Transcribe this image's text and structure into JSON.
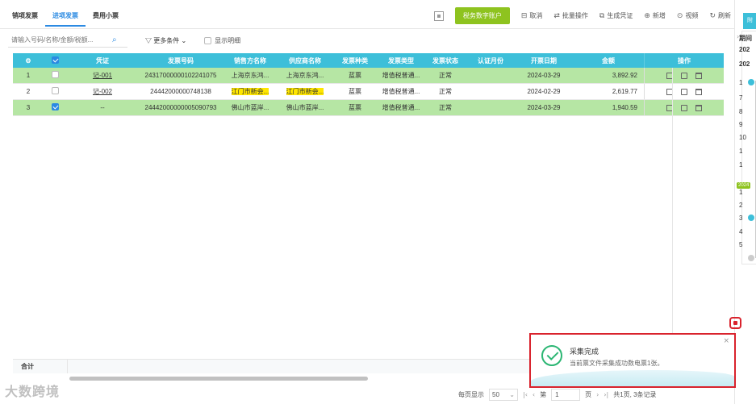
{
  "tabs": [
    {
      "label": "销项发票"
    },
    {
      "label": "进项发票"
    },
    {
      "label": "费用小票"
    }
  ],
  "toolbar": {
    "tax_account_button": "税务数字账户",
    "cancel": "取消",
    "batch": "批量操作",
    "gen_voucher": "生成凭证",
    "add": "新增",
    "video": "视频",
    "refresh": "刷新"
  },
  "filter": {
    "search_placeholder": "请输入号码/名称/金额/税额...",
    "more_conditions": "更多条件",
    "show_detail": "显示明细"
  },
  "table": {
    "headers": [
      "凭证",
      "发票号码",
      "销售方名称",
      "供应商名称",
      "发票种类",
      "发票类型",
      "发票状态",
      "认证月份",
      "开票日期",
      "金额",
      "操作"
    ],
    "rows": [
      {
        "idx": "1",
        "voucher": "记-001",
        "number": "24317000000102241075",
        "seller": "上海京东鸿...",
        "supplier": "上海京东鸿...",
        "kind": "蓝票",
        "type": "增值税普通...",
        "status": "正常",
        "month": "",
        "date": "2024-03-29",
        "amount": "3,892.92",
        "checked": false,
        "highlight": true
      },
      {
        "idx": "2",
        "voucher": "记-002",
        "number": "24442000000748138",
        "seller": "江门市新会...",
        "supplier": "江门市新会...",
        "kind": "蓝票",
        "type": "增值税普通...",
        "status": "正常",
        "month": "",
        "date": "2024-02-29",
        "amount": "2,619.77",
        "checked": false,
        "highlight": false
      },
      {
        "idx": "3",
        "voucher": "--",
        "number": "24442000000005090793",
        "seller": "佛山市蓝岸...",
        "supplier": "佛山市蓝岸...",
        "kind": "蓝票",
        "type": "增值税普通...",
        "status": "正常",
        "month": "",
        "date": "2024-03-29",
        "amount": "1,940.59",
        "checked": true,
        "highlight": true
      }
    ],
    "total_label": "合计"
  },
  "pager": {
    "per_page_label": "每页显示",
    "per_page": "50",
    "page_label_pre": "第",
    "page": "1",
    "page_label_post": "页",
    "summary": "共1页, 3条记录"
  },
  "right_panel": {
    "tab": "附",
    "items": [
      "期间",
      "202",
      "202",
      "1",
      "7",
      "8",
      "9",
      "10",
      "1",
      "1",
      "1",
      "2",
      "3",
      "4",
      "5"
    ],
    "badge": "2024"
  },
  "toast": {
    "title": "采集完成",
    "message": "当前票文件采集成功数电票1张。",
    "close": "×"
  },
  "watermark": "大数跨境",
  "colors": {
    "header_bg": "#3dbfd9",
    "selected_row": "#b6e6a4",
    "accent": "#2b8ae2",
    "green_button": "#8ec31f",
    "alert_red": "#d9232d",
    "success": "#2bb673"
  }
}
